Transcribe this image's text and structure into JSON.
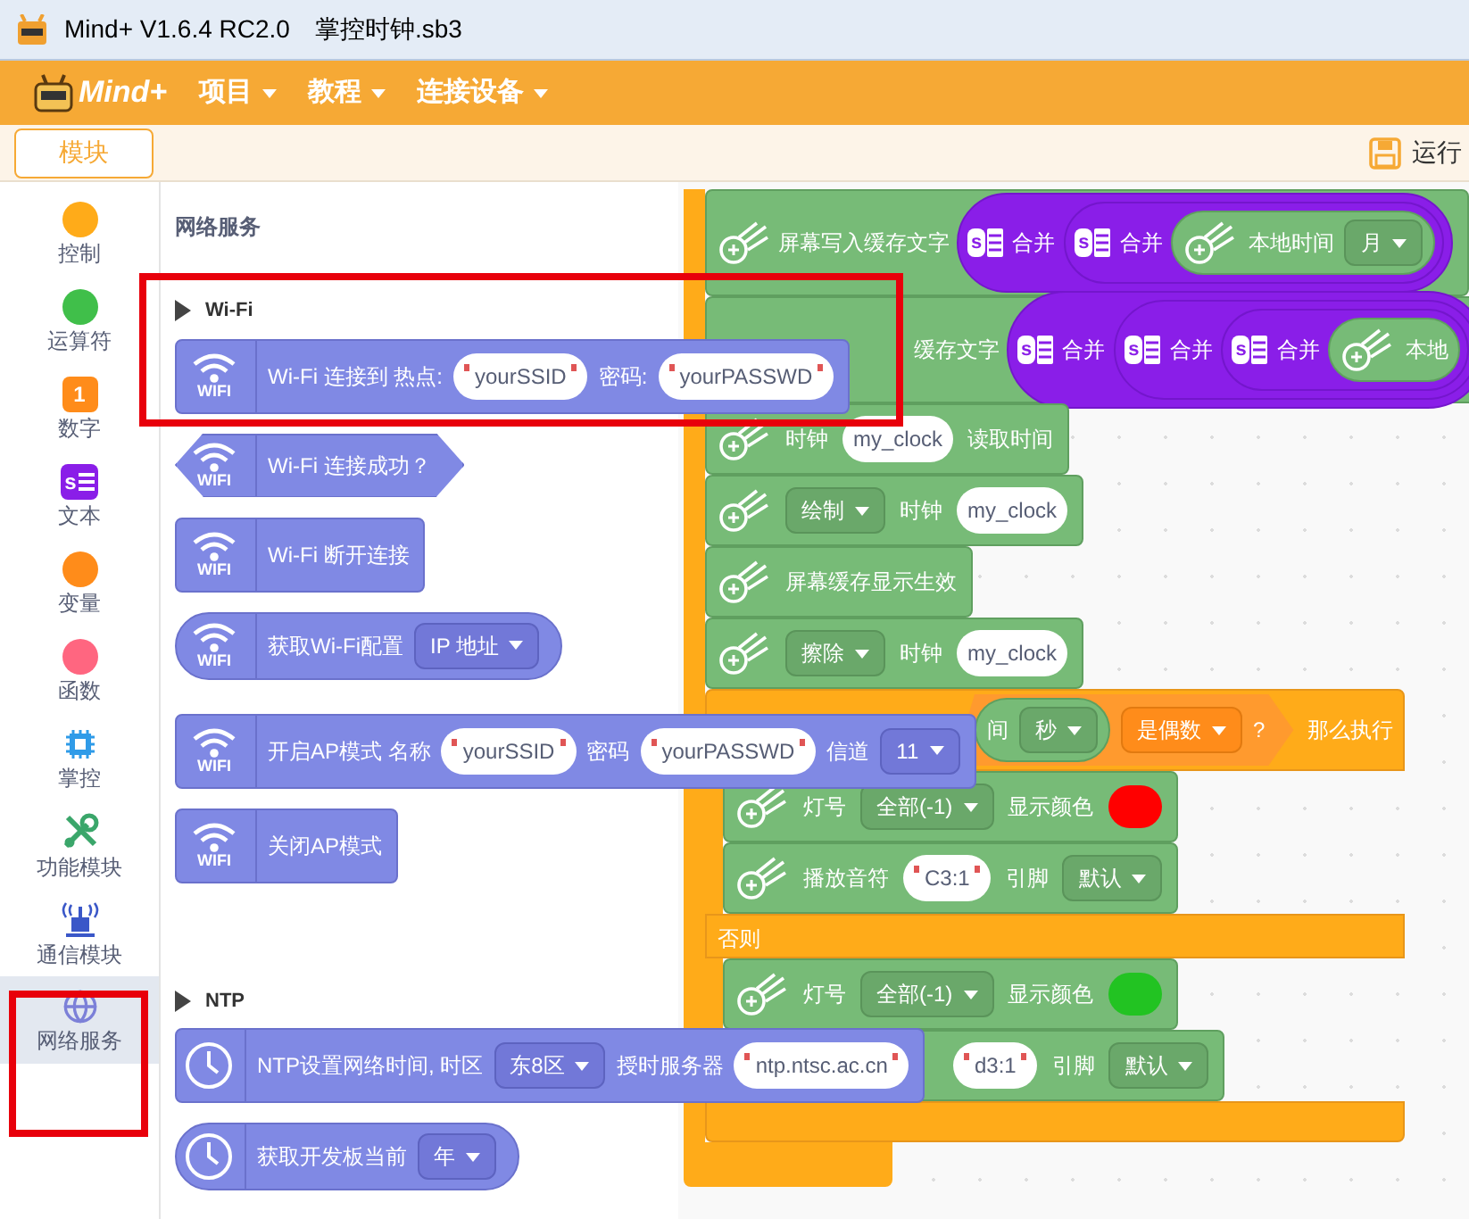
{
  "window": {
    "title": "Mind+ V1.6.4 RC2.0",
    "file": "掌控时钟.sb3"
  },
  "menu": {
    "logo": "Mind+",
    "items": [
      {
        "label": "项目"
      },
      {
        "label": "教程"
      },
      {
        "label": "连接设备"
      }
    ]
  },
  "tabs": [
    {
      "label": "模块",
      "selected": true
    }
  ],
  "run_button": {
    "label": "运行"
  },
  "categories": [
    {
      "label": "控制",
      "kind": "dot",
      "color": "#ffab19",
      "selected": false
    },
    {
      "label": "运算符",
      "kind": "dot",
      "color": "#40bf4a",
      "selected": false
    },
    {
      "label": "数字",
      "kind": "number",
      "icon_text": "1",
      "selected": false
    },
    {
      "label": "文本",
      "kind": "text",
      "icon_text": "s",
      "selected": false
    },
    {
      "label": "变量",
      "kind": "dot",
      "color": "#ff8c1a",
      "selected": false
    },
    {
      "label": "函数",
      "kind": "dot",
      "color": "#ff6680",
      "selected": false
    },
    {
      "label": "掌控",
      "kind": "chip",
      "selected": false
    },
    {
      "label": "功能模块",
      "kind": "tools",
      "selected": false
    },
    {
      "label": "通信模块",
      "kind": "radio",
      "selected": false
    },
    {
      "label": "网络服务",
      "kind": "globe",
      "selected": true
    }
  ],
  "palette": {
    "title": "网络服务",
    "sections": [
      {
        "label": "Wi-Fi",
        "blocks": [
          {
            "kind": "stack",
            "badge": "WIFI",
            "parts": [
              {
                "kind": "text",
                "text": "Wi-Fi 连接到 热点:"
              },
              {
                "kind": "string",
                "text": "yourSSID",
                "quoted": true
              },
              {
                "kind": "text",
                "text": "密码:"
              },
              {
                "kind": "string",
                "text": "yourPASSWD",
                "quoted": true
              }
            ]
          },
          {
            "kind": "boolean",
            "badge": "WIFI",
            "parts": [
              {
                "kind": "text",
                "text": "Wi-Fi 连接成功？"
              }
            ]
          },
          {
            "kind": "stack",
            "badge": "WIFI",
            "parts": [
              {
                "kind": "text",
                "text": "Wi-Fi 断开连接"
              }
            ]
          },
          {
            "kind": "reporter",
            "badge": "WIFI",
            "parts": [
              {
                "kind": "text",
                "text": "获取Wi-Fi配置"
              },
              {
                "kind": "dropdown",
                "text": "IP 地址"
              }
            ]
          },
          {
            "kind": "stack",
            "badge": "WIFI",
            "parts": [
              {
                "kind": "text",
                "text": "开启AP模式 名称"
              },
              {
                "kind": "string",
                "text": "yourSSID",
                "quoted": true
              },
              {
                "kind": "text",
                "text": "密码"
              },
              {
                "kind": "string",
                "text": "yourPASSWD",
                "quoted": true
              },
              {
                "kind": "text",
                "text": "信道"
              },
              {
                "kind": "dropdown",
                "text": "11"
              }
            ]
          },
          {
            "kind": "stack",
            "badge": "WIFI",
            "parts": [
              {
                "kind": "text",
                "text": "关闭AP模式"
              }
            ]
          }
        ]
      },
      {
        "label": "NTP",
        "blocks": [
          {
            "kind": "stack",
            "parts": [
              {
                "kind": "text",
                "text": "NTP设置网络时间, 时区"
              },
              {
                "kind": "dropdown",
                "text": "东8区"
              },
              {
                "kind": "text",
                "text": "授时服务器"
              },
              {
                "kind": "string",
                "text": "ntp.ntsc.ac.cn",
                "quoted": true
              }
            ]
          },
          {
            "kind": "reporter",
            "parts": [
              {
                "kind": "text",
                "text": "获取开发板当前"
              },
              {
                "kind": "dropdown",
                "text": "年"
              }
            ]
          }
        ]
      }
    ]
  },
  "canvas": {
    "stack": [
      {
        "parts": [
          {
            "kind": "text",
            "text": "屏幕写入缓存文字"
          },
          {
            "kind": "join",
            "icon_text": "s",
            "label": "合并",
            "input": {
              "kind": "join",
              "icon_text": "s",
              "label": "合并",
              "input": {
                "kind": "reporter",
                "parts": [
                  {
                    "kind": "text",
                    "text": "本地时间"
                  },
                  {
                    "kind": "dropdown",
                    "text": "月"
                  }
                ]
              }
            }
          }
        ]
      },
      {
        "parts": [
          {
            "kind": "text",
            "text": "缓存文字"
          },
          {
            "kind": "join",
            "icon_text": "s",
            "label": "合并",
            "input": {
              "kind": "join",
              "icon_text": "s",
              "label": "合并",
              "input": {
                "kind": "join",
                "icon_text": "s",
                "label": "合并",
                "input": {
                  "kind": "reporter",
                  "parts": [
                    {
                      "kind": "text",
                      "text": "本地"
                    }
                  ]
                }
              }
            }
          }
        ]
      },
      {
        "parts": [
          {
            "kind": "text",
            "text": "时钟"
          },
          {
            "kind": "string",
            "text": "my_clock",
            "quoted": false
          },
          {
            "kind": "text",
            "text": "读取时间"
          }
        ]
      },
      {
        "parts": [
          {
            "kind": "dropdown",
            "text": "绘制"
          },
          {
            "kind": "text",
            "text": "时钟"
          },
          {
            "kind": "string",
            "text": "my_clock",
            "quoted": false
          }
        ]
      },
      {
        "parts": [
          {
            "kind": "text",
            "text": "屏幕缓存显示生效"
          }
        ]
      },
      {
        "parts": [
          {
            "kind": "dropdown",
            "text": "擦除"
          },
          {
            "kind": "text",
            "text": "时钟"
          },
          {
            "kind": "string",
            "text": "my_clock",
            "quoted": false
          }
        ]
      }
    ],
    "if": {
      "condition": {
        "kind": "boolean",
        "parts": [
          {
            "kind": "reporter",
            "parts": [
              {
                "kind": "text",
                "text": "间"
              },
              {
                "kind": "dropdown",
                "text": "秒"
              }
            ]
          },
          {
            "kind": "dropdown",
            "text": "是偶数"
          },
          {
            "kind": "text",
            "text": "?"
          }
        ]
      },
      "then_label": "那么执行",
      "then": [
        {
          "parts": [
            {
              "kind": "text",
              "text": "灯号"
            },
            {
              "kind": "dropdown",
              "text": "全部(-1)"
            },
            {
              "kind": "text",
              "text": "显示颜色"
            },
            {
              "kind": "color",
              "color": "#ff0000"
            }
          ]
        },
        {
          "parts": [
            {
              "kind": "text",
              "text": "播放音符"
            },
            {
              "kind": "string",
              "text": "C3:1",
              "quoted": true
            },
            {
              "kind": "text",
              "text": "引脚"
            },
            {
              "kind": "dropdown",
              "text": "默认"
            }
          ]
        }
      ],
      "else_label": "否则",
      "else": [
        {
          "parts": [
            {
              "kind": "text",
              "text": "灯号"
            },
            {
              "kind": "dropdown",
              "text": "全部(-1)"
            },
            {
              "kind": "text",
              "text": "显示颜色"
            },
            {
              "kind": "color",
              "color": "#22c322"
            }
          ]
        },
        {
          "parts": [
            {
              "kind": "string",
              "text": "d3:1",
              "quoted": true
            },
            {
              "kind": "text",
              "text": "引脚"
            },
            {
              "kind": "dropdown",
              "text": "默认"
            }
          ]
        }
      ]
    }
  }
}
